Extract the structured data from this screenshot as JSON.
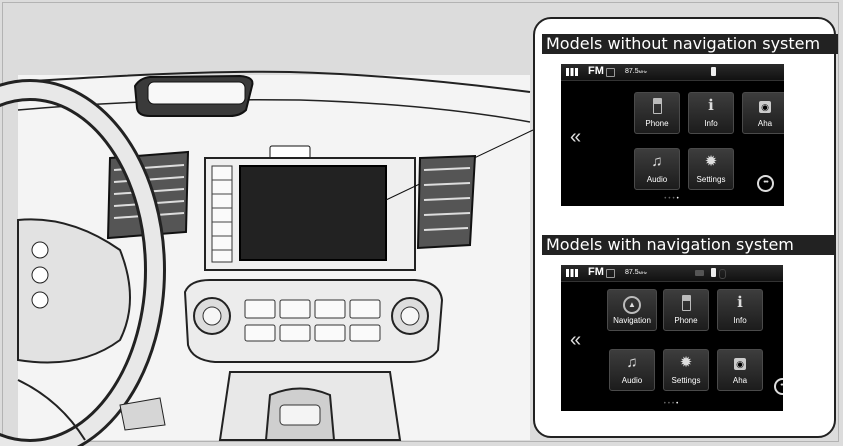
{
  "captions": {
    "without_nav": "Models without navigation system",
    "with_nav": "Models with navigation system"
  },
  "screen_without_nav": {
    "band": "FM",
    "frequency": "87.5",
    "unit": "MHz",
    "tiles": [
      "Phone",
      "Info",
      "Aha",
      "Audio",
      "Settings"
    ]
  },
  "screen_with_nav": {
    "band": "FM",
    "frequency": "87.5",
    "unit": "MHz",
    "tiles": [
      "Navigation",
      "Phone",
      "Info",
      "Audio",
      "Settings",
      "Aha"
    ]
  },
  "icons": {
    "apps": "apps-grid-icon",
    "back": "double-chevron-left-icon",
    "more": "more-dots-icon"
  }
}
